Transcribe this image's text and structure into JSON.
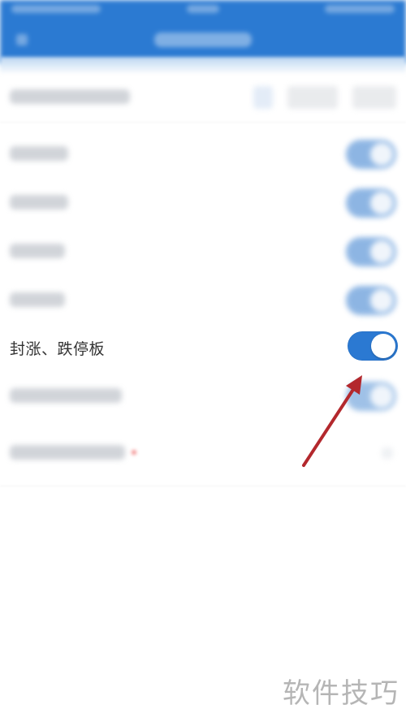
{
  "settings": {
    "focused_row": {
      "label": "封涨、跌停板",
      "toggle_state": "on"
    }
  },
  "colors": {
    "header_blue": "#2b7ad2",
    "toggle_on": "#2b79d2",
    "arrow_red": "#b3282d"
  },
  "watermark": {
    "text": "软件技巧"
  }
}
